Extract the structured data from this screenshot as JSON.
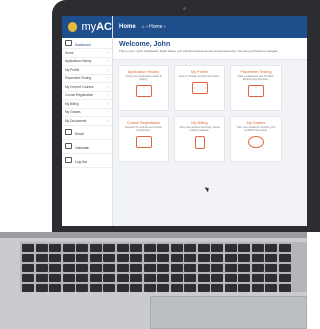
{
  "brand": {
    "name_prefix": "my",
    "name_bold": "AC"
  },
  "topbar": {
    "title": "Home",
    "breadcrumb": "⌂  › Home ›"
  },
  "sidebar": {
    "dashboard": "Dashboard",
    "items": [
      {
        "label": "Home"
      },
      {
        "label": "Application History"
      },
      {
        "label": "My Profile"
      },
      {
        "label": "Placement Testing"
      },
      {
        "label": "My Current Courses"
      },
      {
        "label": "Course Registration"
      },
      {
        "label": "My Billing"
      },
      {
        "label": "My Grades"
      },
      {
        "label": "My Documents"
      }
    ],
    "email": "Email",
    "calendar": "Calendar",
    "logout": "Log Out"
  },
  "welcome": {
    "title": "Welcome, John",
    "subtitle": "This is your myAC dashboard. Right below, you will find various service announcements. Use the grid below to navigate"
  },
  "cards": [
    {
      "title": "Application History",
      "desc": "Check your application status & history."
    },
    {
      "title": "My Profile",
      "desc": "View or change contact information."
    },
    {
      "title": "Placement Testing",
      "desc": "Take a placement test for Math, English and chemistry."
    },
    {
      "title": "Course Registration",
      "desc": "Register for courses and review enrollments."
    },
    {
      "title": "My Billing",
      "desc": "View your account summary, tuition credit or balance."
    },
    {
      "title": "My Grades",
      "desc": "View your academic records, print unofficial transcripts."
    }
  ],
  "colors": {
    "brand": "#1f4e8c",
    "accent": "#e0683a",
    "lid": "#2b2d30"
  }
}
